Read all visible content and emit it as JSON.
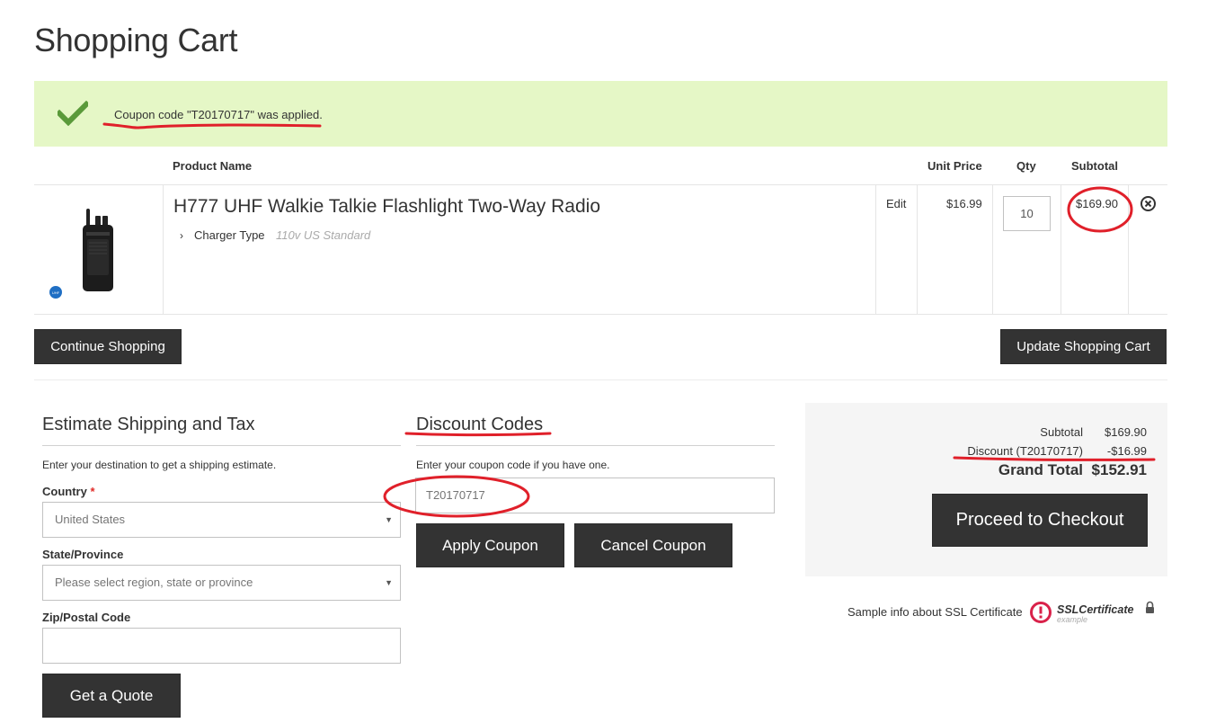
{
  "page": {
    "title": "Shopping Cart"
  },
  "alert": {
    "message": "Coupon code \"T20170717\" was applied.",
    "icon": "checkmark-icon"
  },
  "cart_table": {
    "headers": {
      "product_name": "Product Name",
      "unit_price": "Unit Price",
      "qty": "Qty",
      "subtotal": "Subtotal"
    },
    "items": [
      {
        "name": "H777 UHF Walkie Talkie Flashlight Two-Way Radio",
        "option_label": "Charger Type",
        "option_value": "110v US Standard",
        "edit_label": "Edit",
        "unit_price": "$16.99",
        "qty": "10",
        "subtotal": "$169.90",
        "badge": "UHF"
      }
    ]
  },
  "actions": {
    "continue": "Continue Shopping",
    "update": "Update Shopping Cart"
  },
  "shipping": {
    "title": "Estimate Shipping and Tax",
    "hint": "Enter your destination to get a shipping estimate.",
    "country_label": "Country",
    "required_mark": "*",
    "country_value": "United States",
    "state_label": "State/Province",
    "state_placeholder": "Please select region, state or province",
    "zip_label": "Zip/Postal Code",
    "zip_value": "",
    "quote_button": "Get a Quote"
  },
  "discount": {
    "title": "Discount Codes",
    "hint": "Enter your coupon code if you have one.",
    "code_value": "T20170717",
    "apply_button": "Apply Coupon",
    "cancel_button": "Cancel Coupon"
  },
  "summary": {
    "subtotal_label": "Subtotal",
    "subtotal_value": "$169.90",
    "discount_label": "Discount (T20170717)",
    "discount_value": "-$16.99",
    "grand_total_label": "Grand Total",
    "grand_total_value": "$152.91",
    "checkout_button": "Proceed to Checkout"
  },
  "ssl": {
    "text": "Sample info about SSL Certificate",
    "logo_text": "SSLCertificate",
    "logo_subtext": "example"
  },
  "colors": {
    "alert_bg": "#e5f7c6",
    "check_green": "#5a9a3a",
    "button_dark": "#333333",
    "annotation_red": "#e0202a",
    "required_red": "#e02b27"
  }
}
